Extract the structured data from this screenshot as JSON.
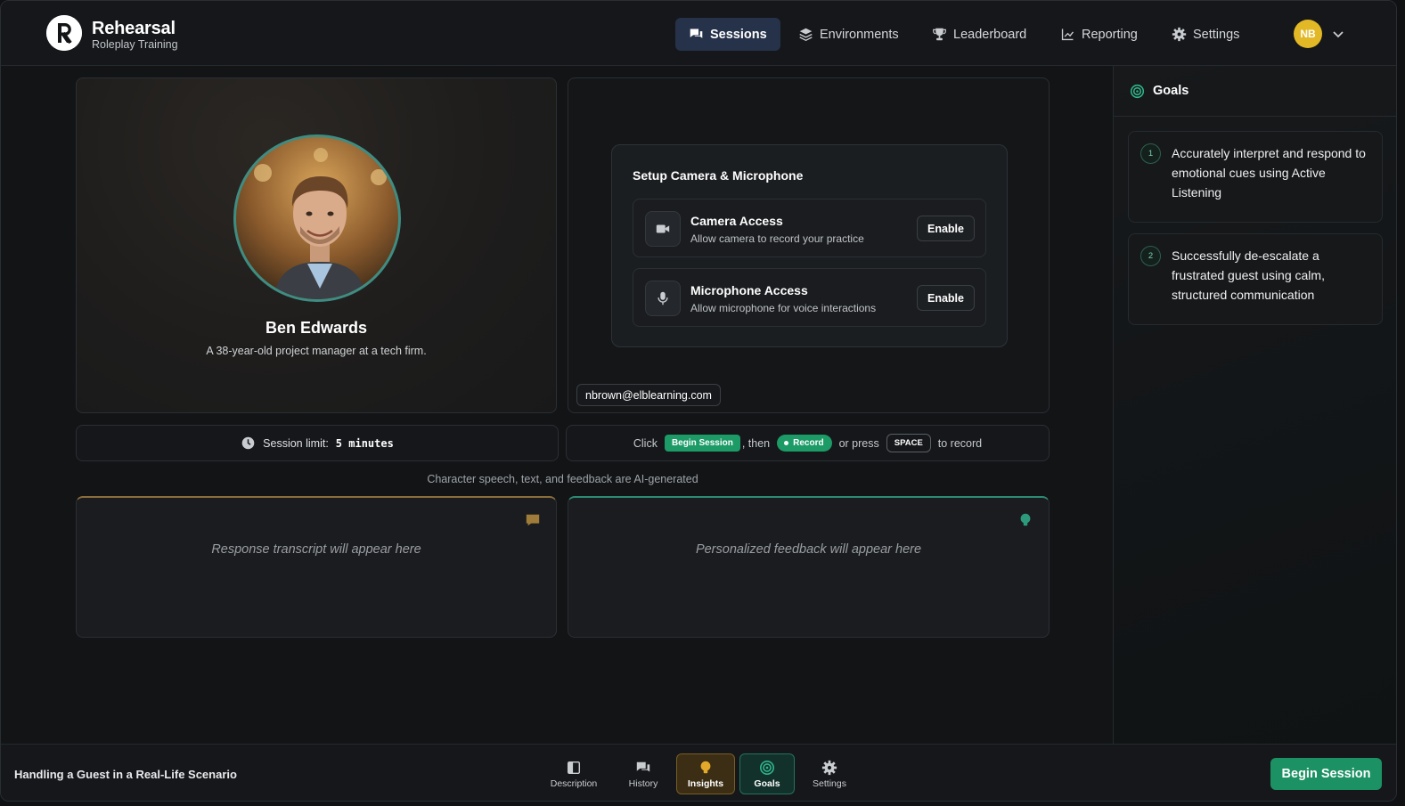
{
  "app": {
    "name": "Rehearsal",
    "subtitle": "Roleplay Training",
    "user_initials": "NB"
  },
  "nav": {
    "items": [
      {
        "label": "Sessions",
        "icon": "chat-bubbles-icon",
        "active": true
      },
      {
        "label": "Environments",
        "icon": "layers-icon",
        "active": false
      },
      {
        "label": "Leaderboard",
        "icon": "trophy-icon",
        "active": false
      },
      {
        "label": "Reporting",
        "icon": "line-chart-icon",
        "active": false
      },
      {
        "label": "Settings",
        "icon": "gear-icon",
        "active": false
      }
    ]
  },
  "character": {
    "name": "Ben Edwards",
    "description": "A 38-year-old project manager at a tech firm."
  },
  "setup": {
    "title": "Setup Camera & Microphone",
    "camera": {
      "title": "Camera Access",
      "description": "Allow camera to record your practice",
      "button": "Enable"
    },
    "microphone": {
      "title": "Microphone Access",
      "description": "Allow microphone for voice interactions",
      "button": "Enable"
    },
    "email": "nbrown@elblearning.com"
  },
  "session": {
    "limit_label": "Session limit:",
    "limit_value": "5 minutes"
  },
  "instructions": {
    "click": "Click",
    "begin_pill": "Begin Session",
    "then": ", then",
    "record_pill": "Record",
    "or_press": "or press",
    "key": "SPACE",
    "to_record": "to record"
  },
  "ai_note": "Character speech, text, and feedback are AI-generated",
  "panels": {
    "transcript_placeholder": "Response transcript will appear here",
    "feedback_placeholder": "Personalized feedback will appear here"
  },
  "goals": {
    "title": "Goals",
    "items": [
      {
        "num": "1",
        "text": "Accurately interpret and respond to emotional cues using Active Listening"
      },
      {
        "num": "2",
        "text": "Successfully de-escalate a frustrated guest using calm, structured communication"
      }
    ]
  },
  "footer": {
    "scenario": "Handling a Guest in a Real-Life Scenario",
    "tabs": [
      {
        "label": "Description"
      },
      {
        "label": "History"
      },
      {
        "label": "Insights"
      },
      {
        "label": "Goals"
      },
      {
        "label": "Settings"
      }
    ],
    "begin_button": "Begin Session"
  },
  "colors": {
    "accent_green": "#1c9264",
    "nav_active": "#25324a",
    "avatar": "#e3b826",
    "insights": "#7a5d23"
  }
}
